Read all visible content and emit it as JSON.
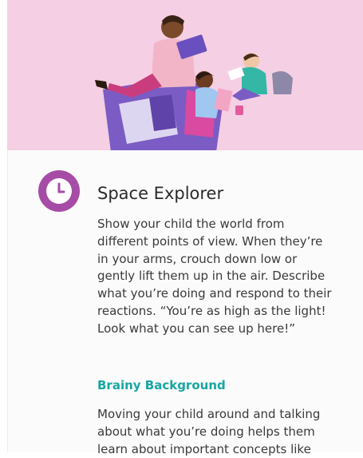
{
  "activity": {
    "title": "Space Explorer",
    "icon": "clock-icon",
    "accent_color": "#a64ca6",
    "description": "Show your child the world from different points of view. When they’re in your arms, crouch down low or gently lift them up in the air. Describe what you’re doing and respond to their reactions. “You’re as high as the light! Look what you can see up here!”"
  },
  "brainy_background": {
    "heading": "Brainy Background",
    "heading_color": "#17a6a1",
    "text": "Moving your child around and talking about what you’re doing helps them learn about important concepts like"
  },
  "hero": {
    "background_color": "#f5cfe3",
    "illustration": "family-reading-illustration"
  }
}
